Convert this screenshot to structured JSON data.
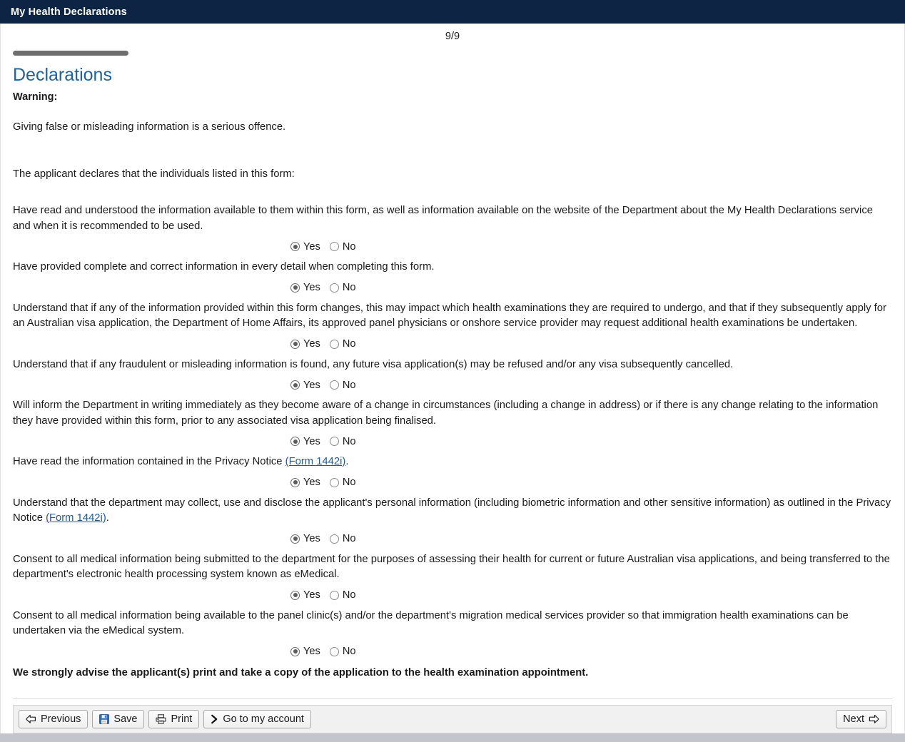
{
  "window": {
    "title": "My Health Declarations",
    "header_bg": "#0d2444"
  },
  "progress": {
    "page_counter": "9/9",
    "current_page": 9,
    "total_pages": 9,
    "bar_color": "#6e6e6e"
  },
  "section": {
    "heading": "Declarations",
    "heading_color": "#20639b",
    "warning_label": "Warning:",
    "warning_text": "Giving false or misleading information is a serious offence.",
    "intro": "The applicant declares that the individuals listed in this form:"
  },
  "radio": {
    "yes_label": "Yes",
    "no_label": "No",
    "selected": "Yes"
  },
  "declarations": [
    {
      "text": "Have read and understood the information available to them within this form, as well as information available on the website of the Department about the My Health Declarations service and when it is recommended to be used.",
      "answer": "Yes"
    },
    {
      "text": "Have provided complete and correct information in every detail when completing this form.",
      "answer": "Yes"
    },
    {
      "text": "Understand that if any of the information provided within this form changes, this may impact which health examinations they are required to undergo, and that if they subsequently apply for an Australian visa application, the Department of Home Affairs, its approved panel physicians or onshore service provider may request additional health examinations be undertaken.",
      "answer": "Yes"
    },
    {
      "text": "Understand that if any fraudulent or misleading information is found, any future visa application(s) may be refused and/or any visa subsequently cancelled.",
      "answer": "Yes"
    },
    {
      "text": "Will inform the Department in writing immediately as they become aware of a change in circumstances (including a change in address) or if there is any change relating to the information they have provided within this form, prior to any associated visa application being finalised.",
      "answer": "Yes"
    },
    {
      "text_before": "Have read the information contained in the Privacy Notice ",
      "link": "(Form 1442i)",
      "text_after": ".",
      "answer": "Yes"
    },
    {
      "text_before": "Understand that the department may collect, use and disclose the applicant's personal information (including biometric information and other sensitive information) as outlined in the Privacy Notice ",
      "link": "(Form 1442i)",
      "text_after": ".",
      "answer": "Yes"
    },
    {
      "text": "Consent to all medical information being submitted to the department for the purposes of assessing their health for current or future Australian visa applications, and being transferred to the department's electronic health processing system known as eMedical.",
      "answer": "Yes"
    },
    {
      "text": "Consent to all medical information being available to the panel clinic(s) and/or the department's migration medical services provider so that immigration health examinations can be undertaken via the eMedical system.",
      "answer": "Yes"
    }
  ],
  "advice": "We strongly advise the applicant(s) print and take a copy of the application to the health examination appointment.",
  "toolbar": {
    "previous_label": "Previous",
    "save_label": "Save",
    "print_label": "Print",
    "account_label": "Go to my account",
    "next_label": "Next",
    "icons": {
      "previous": "arrow-left-outline-icon",
      "save": "floppy-disk-icon",
      "print": "printer-icon",
      "account": "chevron-right-icon",
      "next": "arrow-right-outline-icon"
    }
  }
}
